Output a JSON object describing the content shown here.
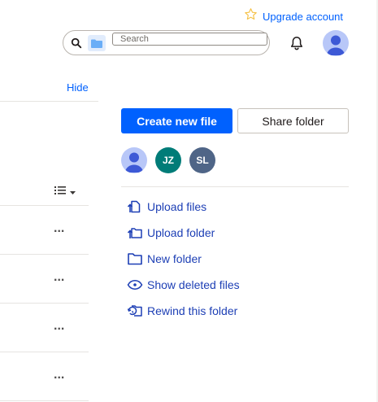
{
  "header": {
    "upgrade_label": "Upgrade account",
    "search": {
      "placeholder": "Search",
      "value": ""
    }
  },
  "sidebar": {
    "hide_label": "Hide",
    "row_menu_label": "..."
  },
  "actions_panel": {
    "create_label": "Create new file",
    "share_label": "Share folder",
    "members": [
      {
        "initials": "",
        "icon": "person-icon",
        "color": "#b8c7f8"
      },
      {
        "initials": "JZ",
        "color": "#007c78"
      },
      {
        "initials": "SL",
        "color": "#4f6587"
      }
    ],
    "links": [
      {
        "label": "Upload files",
        "icon": "upload-file-icon"
      },
      {
        "label": "Upload folder",
        "icon": "upload-folder-icon"
      },
      {
        "label": "New folder",
        "icon": "folder-icon"
      },
      {
        "label": "Show deleted files",
        "icon": "eye-icon"
      },
      {
        "label": "Rewind this folder",
        "icon": "rewind-icon"
      }
    ]
  },
  "colors": {
    "accent": "#0061fe",
    "link": "#1d3fb5",
    "star": "#f5c146"
  }
}
